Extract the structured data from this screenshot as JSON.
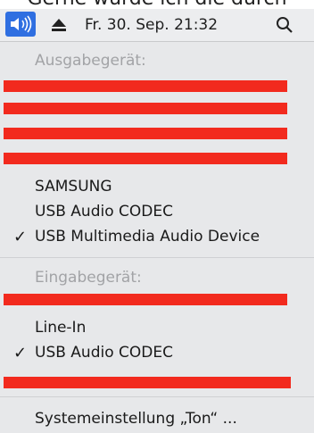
{
  "top_text": "Gerne würde ich die durch",
  "menubar": {
    "clock": "Fr. 30. Sep.  21:32",
    "volume_icon": "speaker-volume-icon",
    "eject_icon": "eject-icon",
    "search_icon": "search-icon",
    "accent_color": "#2f6fe1"
  },
  "output": {
    "header": "Ausgabegerät:",
    "devices": [
      {
        "label": "SAMSUNG",
        "selected": false
      },
      {
        "label": "USB Audio CODEC",
        "selected": false
      },
      {
        "label": "USB Multimedia Audio Device",
        "selected": true
      }
    ]
  },
  "input": {
    "header": "Eingabegerät:",
    "devices": [
      {
        "label": "Line-In",
        "selected": false
      },
      {
        "label": "USB Audio CODEC",
        "selected": true
      }
    ]
  },
  "settings_label": "Systemeinstellung „Ton“ ...",
  "checkmark": "✓",
  "redaction_color": "#f22a1e"
}
